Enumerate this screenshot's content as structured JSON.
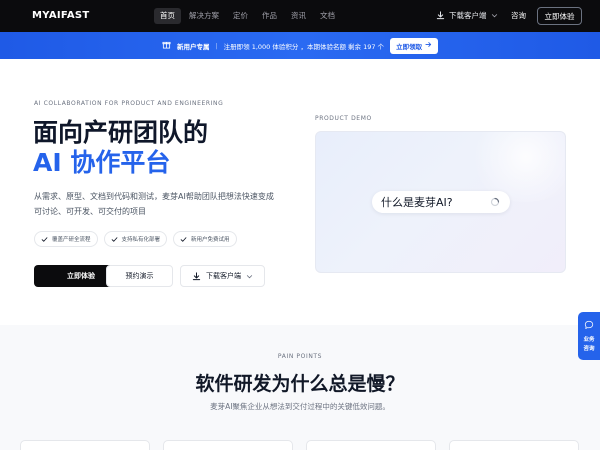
{
  "nav": {
    "logo": "MYAIFAST",
    "links": [
      {
        "label": "首页",
        "active": true
      },
      {
        "label": "解决方案",
        "active": false
      },
      {
        "label": "定价",
        "active": false
      },
      {
        "label": "作品",
        "active": false
      },
      {
        "label": "资讯",
        "active": false
      },
      {
        "label": "文档",
        "active": false
      }
    ],
    "download_label": "下载客户端",
    "consult_label": "咨询",
    "try_label": "立即体验"
  },
  "banner": {
    "badge": "新用户专属",
    "text": "注册即领 1,000 体验积分 ，本期体验名额 剩余 197 个",
    "claim_label": "立即领取"
  },
  "hero": {
    "eyebrow": "AI COLLABORATION FOR PRODUCT AND ENGINEERING",
    "title_line1": "面向产研团队的",
    "title_line2": "AI 协作平台",
    "description": "从需求、原型、文档到代码和测试，麦芽AI帮助团队把想法快速变成可讨论、可开发、可交付的项目",
    "tags": [
      "覆盖产研全流程",
      "支持私有化部署",
      "新用户免费试用"
    ],
    "primary_button": "立即体验",
    "secondary_button": "预约演示",
    "download_button": "下载客户端"
  },
  "demo": {
    "label": "PRODUCT DEMO",
    "query": "什么是麦芽AI?"
  },
  "pain_points": {
    "eyebrow": "PAIN POINTS",
    "title": "软件研发为什么总是慢？",
    "subtitle": "麦芽AI聚焦企业从想法到交付过程中的关键低效问题。"
  },
  "float_consult": {
    "line1": "业务",
    "line2": "咨询"
  },
  "colors": {
    "accent": "#2563eb",
    "nav_bg": "#0b0b0d",
    "banner_bg": "#1f5ae6"
  }
}
